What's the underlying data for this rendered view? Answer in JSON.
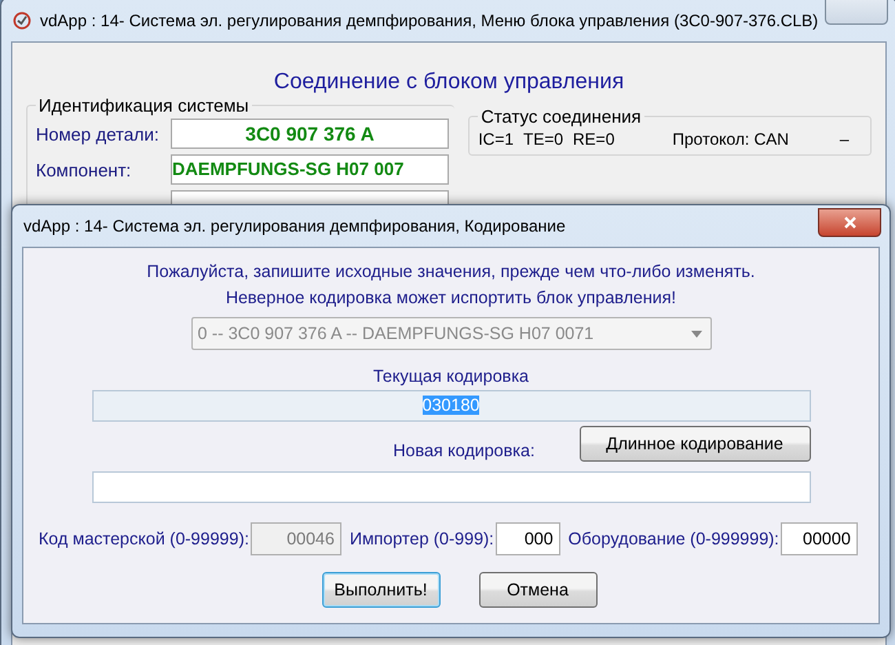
{
  "main_window": {
    "title": "vdApp : 14- Система эл. регулирования демпфирования,  Меню блока управления (3C0-907-376.CLB)",
    "heading": "Соединение с блоком управления",
    "identification": {
      "title": "Идентификация системы",
      "fields": [
        {
          "label": "Номер детали:",
          "value": "3C0 907 376 A"
        },
        {
          "label": "Компонент:",
          "value": "DAEMPFUNGS-SG H07 007"
        }
      ]
    },
    "status": {
      "title": "Статус соединения",
      "ic": "IC=1",
      "te": "TE=0",
      "re": "RE=0",
      "protocol": "Протокол: CAN",
      "extra": "–"
    }
  },
  "dialog": {
    "title": "vdApp : 14- Система эл. регулирования демпфирования,  Кодирование",
    "warnings": [
      "Пожалуйста, запишите исходные значения, прежде чем что-либо изменять.",
      "Неверное кодировка может испортить блок управления!"
    ],
    "module_select": {
      "value": "0 -- 3C0 907 376 A -- DAEMPFUNGS-SG H07 0071",
      "disabled": true
    },
    "current_coding": {
      "label": "Текущая кодировка",
      "value": "030180",
      "selected": true
    },
    "new_coding": {
      "label": "Новая кодировка:",
      "button": "Длинное кодирование"
    },
    "codes": [
      {
        "label": "Код мастерской (0-99999):",
        "value": "00046",
        "disabled": true
      },
      {
        "label": "Импортер (0-999):",
        "value": "000",
        "disabled": false
      },
      {
        "label": "Оборудование (0-999999):",
        "value": "00000",
        "disabled": false
      }
    ],
    "buttons": [
      {
        "label": "Выполнить!",
        "default": true
      },
      {
        "label": "Отмена",
        "default": false
      }
    ]
  }
}
